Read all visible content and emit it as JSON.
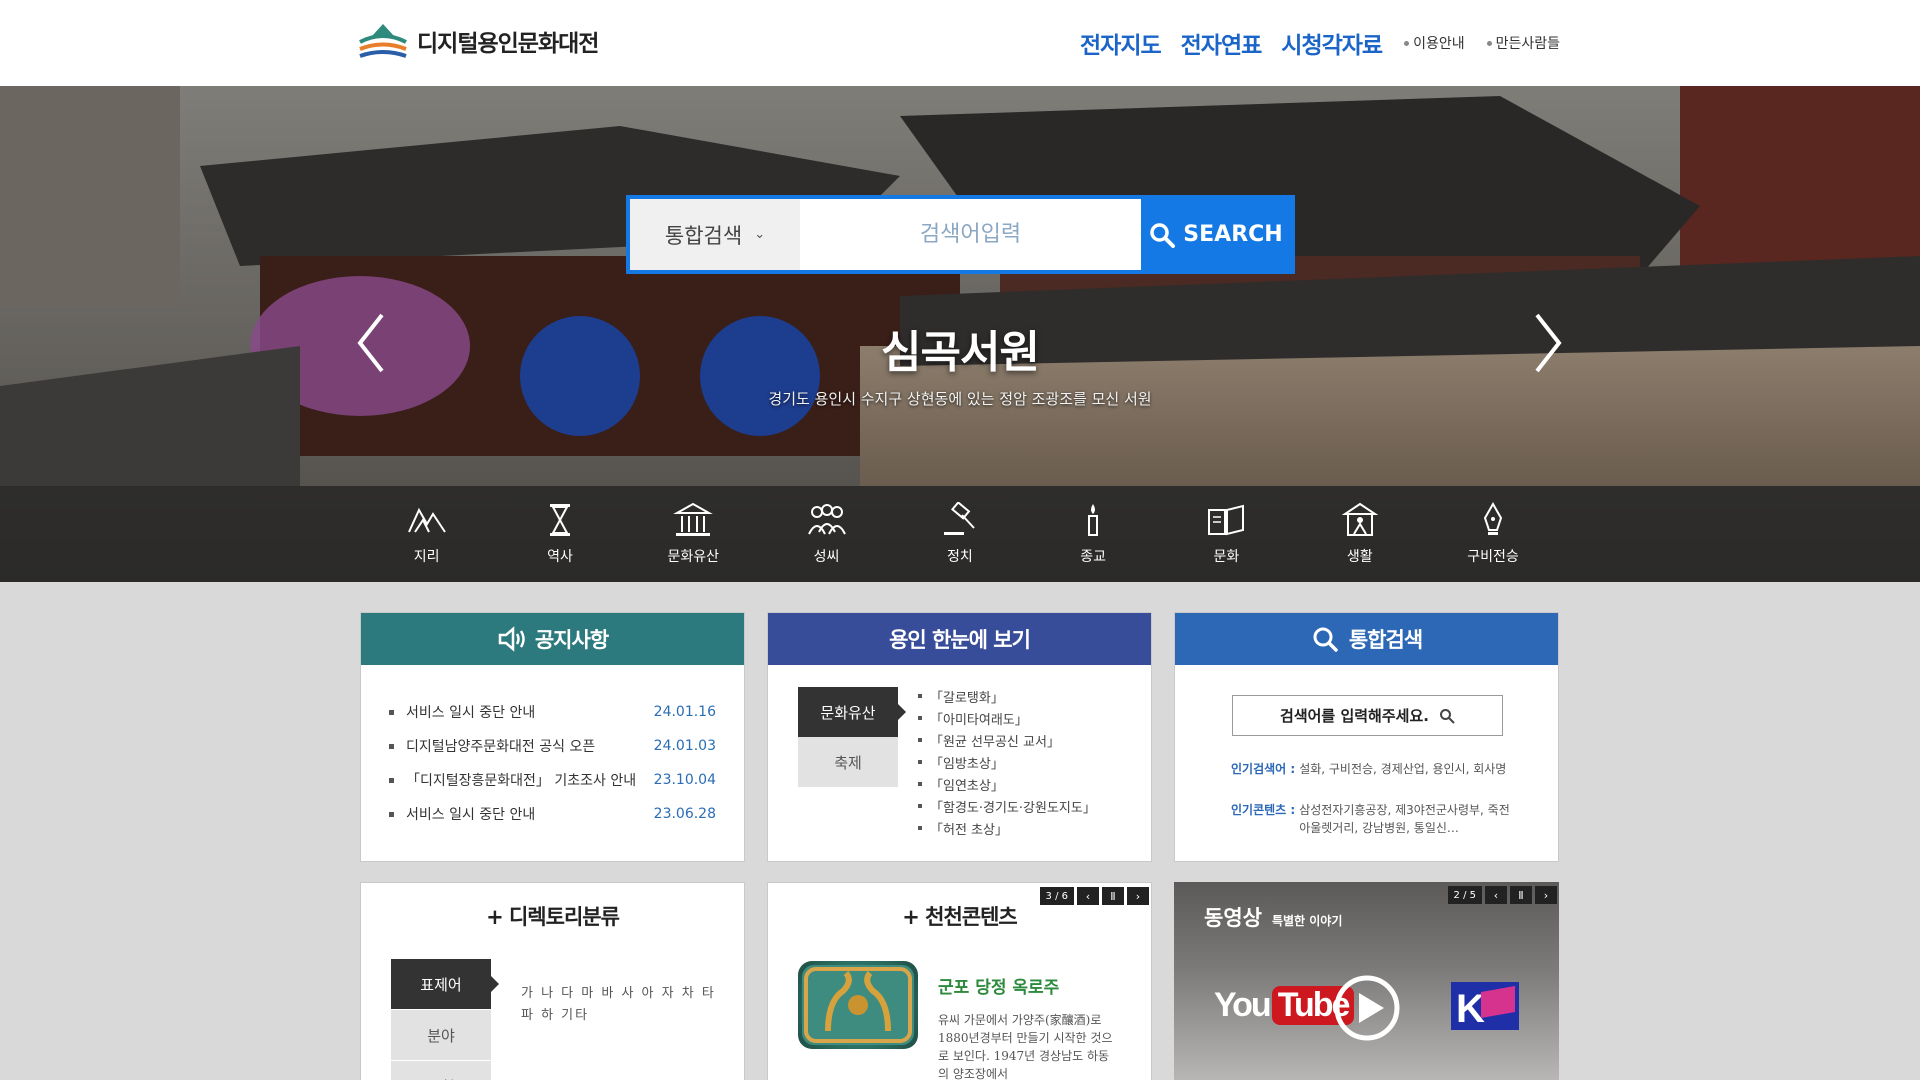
{
  "site": {
    "logo_text": "디지털용인문화대전"
  },
  "nav": {
    "main": [
      "전자지도",
      "전자연표",
      "시청각자료"
    ],
    "sub": [
      "이용안내",
      "만든사람들"
    ]
  },
  "search": {
    "scope": "통합검색",
    "placeholder": "검색어입력",
    "button": "SEARCH"
  },
  "hero": {
    "title": "심곡서원",
    "subtitle": "경기도 용인시 수지구 상현동에 있는 정암 조광조를 모신 서원"
  },
  "categories": [
    {
      "label": "지리",
      "icon": "mountain-icon"
    },
    {
      "label": "역사",
      "icon": "hourglass-icon"
    },
    {
      "label": "문화유산",
      "icon": "temple-icon"
    },
    {
      "label": "성씨",
      "icon": "people-icon"
    },
    {
      "label": "정치",
      "icon": "gavel-icon"
    },
    {
      "label": "종교",
      "icon": "candle-icon"
    },
    {
      "label": "문화",
      "icon": "book-icon"
    },
    {
      "label": "생활",
      "icon": "home-person-icon"
    },
    {
      "label": "구비전승",
      "icon": "pen-icon"
    }
  ],
  "notice": {
    "title": "공지사항",
    "items": [
      {
        "title": "서비스 일시 중단 안내",
        "date": "24.01.16"
      },
      {
        "title": "디지털남양주문화대전 공식 오픈",
        "date": "24.01.03"
      },
      {
        "title": "「디지털장흥문화대전」 기초조사 안내",
        "date": "23.10.04"
      },
      {
        "title": "서비스 일시 중단 안내",
        "date": "23.06.28"
      }
    ]
  },
  "glance": {
    "title": "용인 한눈에 보기",
    "tabs": [
      "문화유산",
      "축제"
    ],
    "items": [
      "「갈로탱화」",
      "「아미타여래도」",
      "「원균 선무공신 교서」",
      "「임방초상」",
      "「임연초상」",
      "「함경도·경기도·강원도지도」",
      "「허전 초상」"
    ]
  },
  "unified_search": {
    "title": "통합검색",
    "placeholder": "검색어를 입력해주세요.",
    "popular_keywords_label": "인기검색어 :",
    "popular_keywords": "설화, 구비전승, 경제산업, 용인시, 회사명",
    "popular_contents_label": "인기콘텐츠 :",
    "popular_contents": "삼성전자기흥공장, 제3야전군사령부, 죽전 아울렛거리, 강남병원, 통일신…"
  },
  "directory": {
    "title": "+ 디렉토리분류",
    "tabs": [
      "표제어",
      "분야",
      "유형"
    ],
    "chars": "가 나 다 마 바 사 아 자 차 타 파 하 기타"
  },
  "recommend": {
    "title": "+ 천천콘텐츠",
    "page": "3 / 6",
    "name": "군포 당정 옥로주",
    "desc": "유씨 가문에서 가양주(家釀酒)로 1880년경부터 만들기 시작한 것으로 보인다. 1947년 경상남도 하동의 양조장에서"
  },
  "video": {
    "title": "동영상",
    "subtitle": "특별한 이야기",
    "page": "2 / 5",
    "yt_you": "You",
    "yt_tube": "Tube"
  },
  "colors": {
    "accent": "#1479e4",
    "notice_head": "#2d7a7e",
    "glance_head": "#384d9a",
    "search_head": "#2c68b6",
    "nav_link": "#1b64c8"
  }
}
